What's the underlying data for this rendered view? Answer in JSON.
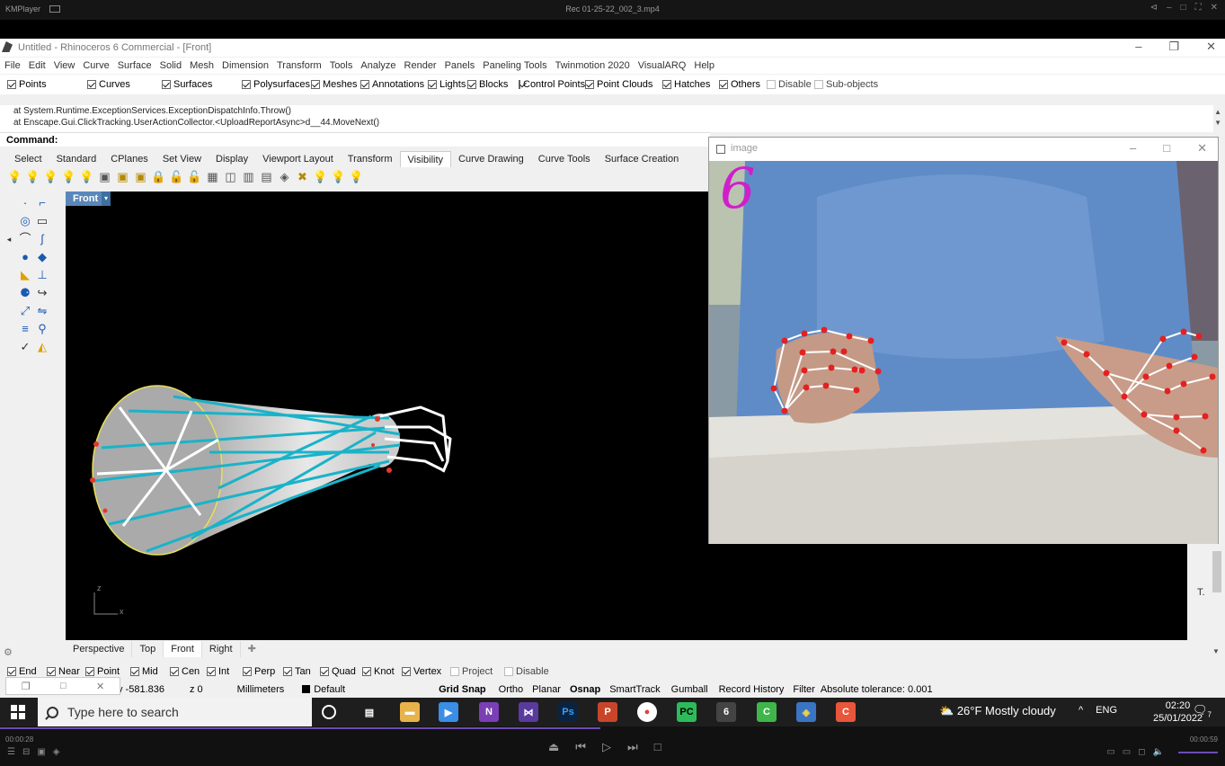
{
  "player": {
    "app_name": "KMPlayer",
    "file_name": "Rec 01-25-22_002_3.mp4",
    "elapsed": "00:00:28",
    "duration": "00:00:59",
    "progress_fraction": 0.49
  },
  "rhino": {
    "title": "Untitled - Rhinoceros 6 Commercial - [Front]",
    "menu": [
      "File",
      "Edit",
      "View",
      "Curve",
      "Surface",
      "Solid",
      "Mesh",
      "Dimension",
      "Transform",
      "Tools",
      "Analyze",
      "Render",
      "Panels",
      "Paneling Tools",
      "Twinmotion 2020",
      "VisualARQ",
      "Help"
    ],
    "filters": [
      {
        "label": "Points",
        "checked": true
      },
      {
        "label": "Curves",
        "checked": true
      },
      {
        "label": "Surfaces",
        "checked": true
      },
      {
        "label": "Polysurfaces",
        "checked": true
      },
      {
        "label": "Meshes",
        "checked": true
      },
      {
        "label": "Annotations",
        "checked": true
      },
      {
        "label": "Lights",
        "checked": true
      },
      {
        "label": "Blocks",
        "checked": true
      },
      {
        "label": "Control Points",
        "checked": true
      },
      {
        "label": "Point Clouds",
        "checked": true
      },
      {
        "label": "Hatches",
        "checked": true
      },
      {
        "label": "Others",
        "checked": true
      },
      {
        "label": "Disable",
        "checked": false
      },
      {
        "label": "Sub-objects",
        "checked": false
      }
    ],
    "history_lines": [
      "at System.Runtime.ExceptionServices.ExceptionDispatchInfo.Throw()",
      "at Enscape.Gui.ClickTracking.UserActionCollector.<UploadReportAsync>d__44.MoveNext()"
    ],
    "command_label": "Command:",
    "toolbar_tabs": [
      "Select",
      "Standard",
      "CPlanes",
      "Set View",
      "Display",
      "Viewport Layout",
      "Transform",
      "Visibility",
      "Curve Drawing",
      "Curve Tools",
      "Surface Creation"
    ],
    "active_tab": "Visibility",
    "viewport_name": "Front",
    "viewport_tabs": [
      "Perspective",
      "Top",
      "Front",
      "Right"
    ],
    "active_viewport_tab": "Front",
    "axis_labels": {
      "z": "z",
      "x": "x"
    },
    "osnaps": [
      {
        "label": "End",
        "checked": true
      },
      {
        "label": "Near",
        "checked": true
      },
      {
        "label": "Point",
        "checked": true
      },
      {
        "label": "Mid",
        "checked": true
      },
      {
        "label": "Cen",
        "checked": true
      },
      {
        "label": "Int",
        "checked": true
      },
      {
        "label": "Perp",
        "checked": true
      },
      {
        "label": "Tan",
        "checked": true
      },
      {
        "label": "Quad",
        "checked": true
      },
      {
        "label": "Knot",
        "checked": true
      },
      {
        "label": "Vertex",
        "checked": true
      },
      {
        "label": "Project",
        "checked": false
      },
      {
        "label": "Disable",
        "checked": false
      }
    ],
    "status": {
      "y_coord": "y -581.836",
      "z_coord": "z 0",
      "units": "Millimeters",
      "layer": "Default",
      "grid_snap": "Grid Snap",
      "ortho": "Ortho",
      "planar": "Planar",
      "osnap": "Osnap",
      "smarttrack": "SmartTrack",
      "gumball": "Gumball",
      "record_history": "Record History",
      "filter": "Filter",
      "tolerance": "Absolute tolerance: 0.001"
    },
    "side_label": "T."
  },
  "image_window": {
    "title": "image",
    "finger_count": "6"
  },
  "taskbar": {
    "search_placeholder": "Type here to search",
    "weather": "26°F  Mostly cloudy",
    "language": "ENG",
    "time": "02:20",
    "date": "25/01/2022",
    "notification_count": "7"
  }
}
